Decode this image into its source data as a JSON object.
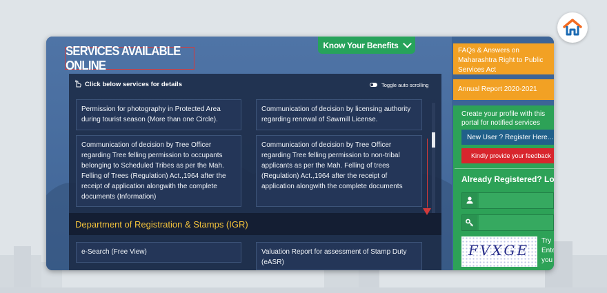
{
  "colors": {
    "page_bg": "#dfe4e8",
    "window_blue": "#45679a",
    "panel_dark": "#1b2a46",
    "benefits_green": "#27a35b",
    "orange": "#f2a124",
    "green_panel": "#2da257",
    "highlight_red": "#d93a3a",
    "dept_yellow": "#f3c23b"
  },
  "header": {
    "benefits_label": "Know Your Benefits",
    "benefits_icon": "chevron-down-icon",
    "section_title": "SERVICES AVAILABLE ONLINE"
  },
  "panel": {
    "instruction": "Click below services for details",
    "instruction_icon": "pointer-hand-icon",
    "toggle_label": "Toggle auto scrolling",
    "services": [
      "Permission for photography in Protected Area during tourist season (More than one Circle).",
      "Communication of decision by licensing authority regarding renewal of Sawmill License.",
      "Communication of decision by Tree Officer regarding Tree felling permission to occupants belonging to Scheduled Tribes as per the Mah. Felling of Trees (Regulation) Act.,1964 after the receipt of application alongwith the complete documents (Information)",
      "Communication of decision by Tree Officer regarding Tree felling permission to non-tribal applicants as per the Mah. Felling of trees (Regulation) Act.,1964 after the receipt of application alongwith the complete documents"
    ],
    "department": "Department of Registration & Stamps (IGR)",
    "dept_services": [
      "e-Search (Free View)",
      "Valuation Report for assessment of Stamp Duty (eASR)"
    ]
  },
  "sidebar": {
    "faq_text": "FAQs & Answers on Maharashtra Right to Public Services Act",
    "annual_report": "Annual Report 2020-2021",
    "profile_text": "Create your profile with this portal for notified services",
    "register_button": "New User ? Register Here...",
    "feedback_button": "Kindly provide your feedback",
    "already_registered": "Already Registered? Login",
    "username_icon": "user-icon",
    "password_icon": "key-icon",
    "captcha_text": "FVXGE",
    "captcha_hint": "Try Enter you"
  }
}
